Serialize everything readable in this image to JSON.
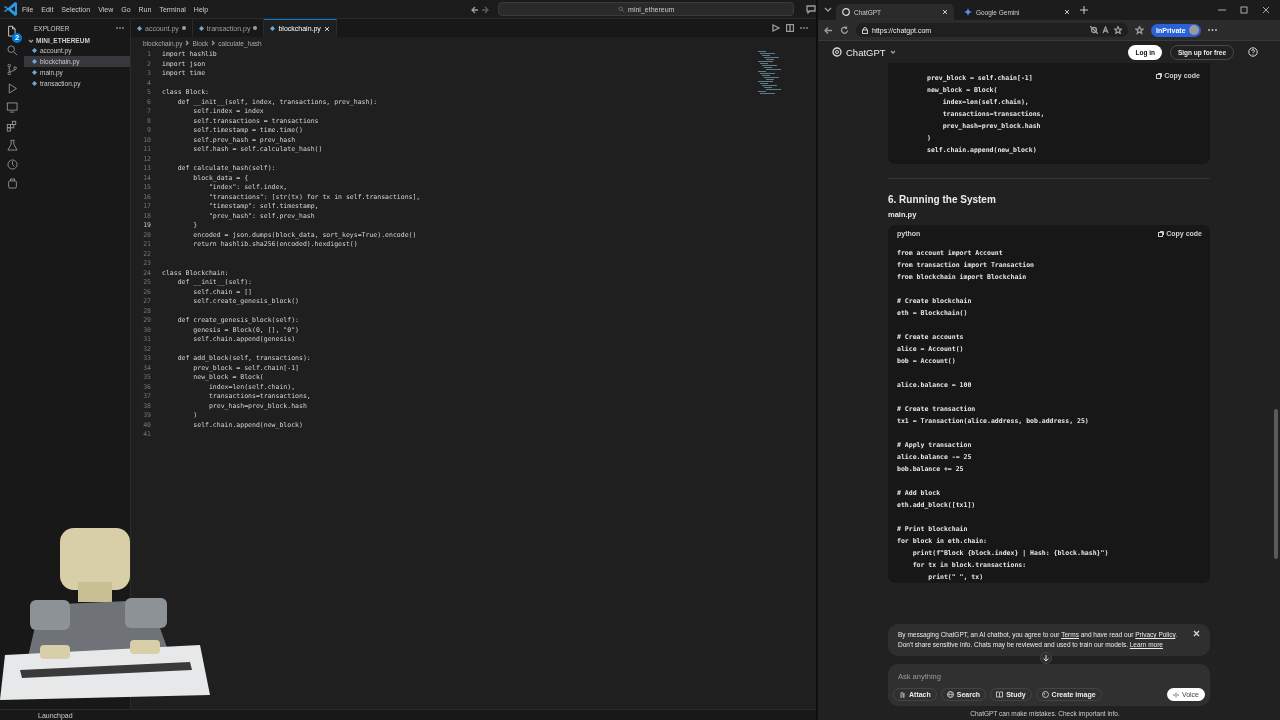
{
  "vscode": {
    "menu": [
      "File",
      "Edit",
      "Selection",
      "View",
      "Go",
      "Run",
      "Terminal",
      "Help"
    ],
    "command_center": "mini_ethereum",
    "explorer_badge": "2",
    "explorer": {
      "title": "EXPLORER",
      "folder": "MINI_ETHEREUM",
      "expanded": true,
      "files": [
        {
          "name": "account.py",
          "selected": false
        },
        {
          "name": "blockchain.py",
          "selected": true
        },
        {
          "name": "main.py",
          "selected": false
        },
        {
          "name": "transaction.py",
          "selected": false
        }
      ]
    },
    "tabs": [
      {
        "label": "account.py",
        "modified": true,
        "selected": false
      },
      {
        "label": "transaction.py",
        "modified": true,
        "selected": false
      },
      {
        "label": "blockchain.py",
        "modified": false,
        "selected": true
      }
    ],
    "breadcrumb": [
      "blockchain.py",
      "Block",
      "calculate_hash"
    ],
    "lines": [
      {
        "n": "1",
        "text": "import hashlib",
        "current": false
      },
      {
        "n": "2",
        "text": "import json",
        "current": false
      },
      {
        "n": "3",
        "text": "import time",
        "current": false
      },
      {
        "n": "4",
        "current": false
      },
      {
        "n": "5",
        "text": "class Block:",
        "current": false
      },
      {
        "n": "6",
        "text": "    def __init__(self, index, transactions, prev_hash):",
        "current": false
      },
      {
        "n": "7",
        "text": "        self.index = index",
        "current": false
      },
      {
        "n": "8",
        "text": "        self.transactions = transactions",
        "current": false
      },
      {
        "n": "9",
        "text": "        self.timestamp = time.time()",
        "current": false
      },
      {
        "n": "10",
        "text": "        self.prev_hash = prev_hash",
        "current": false
      },
      {
        "n": "11",
        "text": "        self.hash = self.calculate_hash()",
        "current": false
      },
      {
        "n": "12",
        "current": false
      },
      {
        "n": "13",
        "text": "    def calculate_hash(self):",
        "current": false
      },
      {
        "n": "14",
        "text": "        block_data = {",
        "current": false
      },
      {
        "n": "15",
        "text": "            \"index\": self.index,",
        "current": false
      },
      {
        "n": "16",
        "text": "            \"transactions\": [str(tx) for tx in self.transactions],",
        "current": false
      },
      {
        "n": "17",
        "text": "            \"timestamp\": self.timestamp,",
        "current": false
      },
      {
        "n": "18",
        "text": "            \"prev_hash\": self.prev_hash",
        "current": false
      },
      {
        "n": "19",
        "text": "        }",
        "current": true
      },
      {
        "n": "20",
        "text": "        encoded = json.dumps(block_data, sort_keys=True).encode()",
        "current": false
      },
      {
        "n": "21",
        "text": "        return hashlib.sha256(encoded).hexdigest()",
        "current": false
      },
      {
        "n": "22",
        "current": false
      },
      {
        "n": "23",
        "current": false
      },
      {
        "n": "24",
        "text": "class Blockchain:",
        "current": false
      },
      {
        "n": "25",
        "text": "    def __init__(self):",
        "current": false
      },
      {
        "n": "26",
        "text": "        self.chain = []",
        "current": false
      },
      {
        "n": "27",
        "text": "        self.create_genesis_block()",
        "current": false
      },
      {
        "n": "28",
        "current": false
      },
      {
        "n": "29",
        "text": "    def create_genesis_block(self):",
        "current": false
      },
      {
        "n": "30",
        "text": "        genesis = Block(0, [], \"0\")",
        "current": false
      },
      {
        "n": "31",
        "text": "        self.chain.append(genesis)",
        "current": false
      },
      {
        "n": "32",
        "current": false
      },
      {
        "n": "33",
        "text": "    def add_block(self, transactions):",
        "current": false
      },
      {
        "n": "34",
        "text": "        prev_block = self.chain[-1]",
        "current": false
      },
      {
        "n": "35",
        "text": "        new_block = Block(",
        "current": false
      },
      {
        "n": "36",
        "text": "            index=len(self.chain),",
        "current": false
      },
      {
        "n": "37",
        "text": "            transactions=transactions,",
        "current": false
      },
      {
        "n": "38",
        "text": "            prev_hash=prev_block.hash",
        "current": false
      },
      {
        "n": "39",
        "text": "        )",
        "current": false
      },
      {
        "n": "40",
        "text": "        self.chain.append(new_block)",
        "current": false
      },
      {
        "n": "41",
        "current": false
      }
    ],
    "status_bar": {
      "text": "Launchpad"
    }
  },
  "browser": {
    "tabs": [
      {
        "title": "ChatGPT",
        "selected": true
      },
      {
        "title": "Google Gemini",
        "selected": false
      }
    ],
    "url": "https://chatgpt.com",
    "profile": "InPrivate",
    "chat": {
      "brand": "ChatGPT",
      "login": "Log in",
      "signup": "Sign up for free",
      "blocks": [
        {
          "kind": "code",
          "copy": "Copy code",
          "code": "prev_block = self.chain[-1]\nnew_block = Block(\n    index=len(self.chain),\n    transactions=transactions,\n    prev_hash=prev_block.hash\n)\nself.chain.append(new_block)"
        },
        {
          "kind": "rule"
        },
        {
          "kind": "heading",
          "text": "6. Running the System"
        },
        {
          "kind": "filename",
          "text": "main.py"
        },
        {
          "kind": "code",
          "language": "python",
          "copy": "Copy code",
          "code": "from account import Account\nfrom transaction import Transaction\nfrom blockchain import Blockchain\n\n# Create blockchain\neth = Blockchain()\n\n# Create accounts\nalice = Account()\nbob = Account()\n\nalice.balance = 100\n\n# Create transaction\ntx1 = Transaction(alice.address, bob.address, 25)\n\n# Apply transaction\nalice.balance -= 25\nbob.balance += 25\n\n# Add block\neth.add_block([tx1])\n\n# Print blockchain\nfor block in eth.chain:\n    print(f\"Block {block.index} | Hash: {block.hash}\")\n    for tx in block.transactions:\n        print(\" \", tx)"
        }
      ],
      "notice": [
        [
          {
            "kind": "text",
            "text": "By messaging ChatGPT, an AI chatbot, you agree to our "
          },
          {
            "kind": "link",
            "text": "Terms"
          },
          {
            "kind": "text",
            "text": " and have read our "
          },
          {
            "kind": "link",
            "text": "Privacy Policy"
          },
          {
            "kind": "text",
            "text": "."
          }
        ],
        [
          {
            "kind": "text",
            "text": "Don't share sensitive info. Chats may be reviewed and used to train our models. "
          },
          {
            "kind": "link",
            "text": "Learn more"
          }
        ]
      ],
      "composer": {
        "placeholder": "Ask anything",
        "tools": [
          "Attach",
          "Search",
          "Study",
          "Create image"
        ],
        "voice": "Voice"
      },
      "footer": "ChatGPT can make mistakes. Check important info."
    }
  }
}
